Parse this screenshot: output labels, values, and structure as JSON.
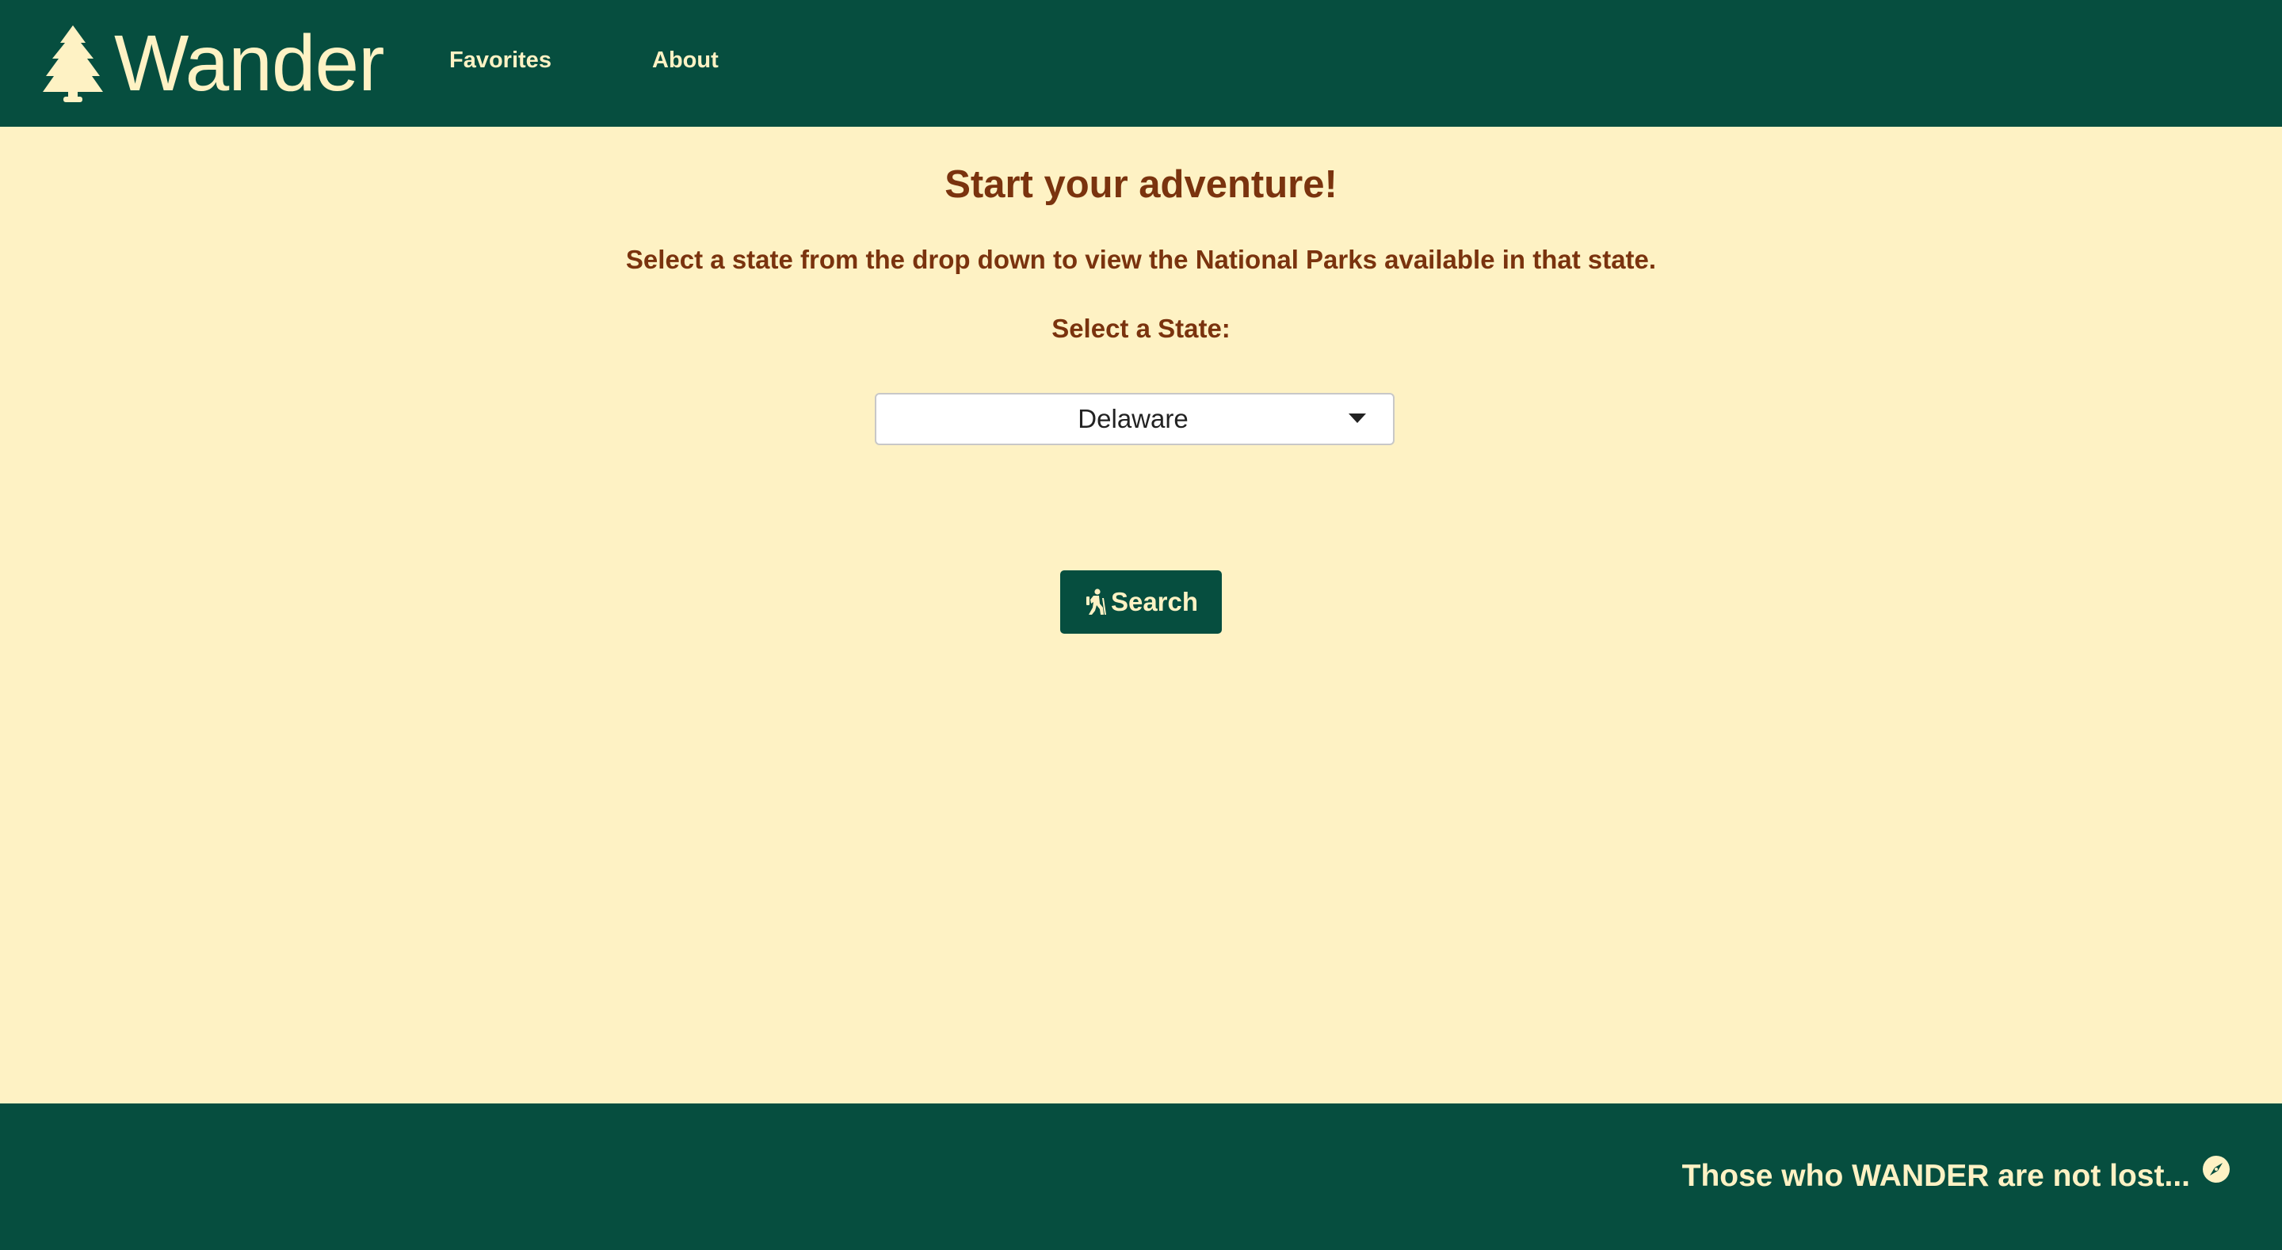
{
  "header": {
    "brand": "Wander",
    "brand_icon": "tree-icon",
    "nav": [
      {
        "label": "Favorites"
      },
      {
        "label": "About"
      }
    ]
  },
  "main": {
    "heading": "Start your adventure!",
    "instructions": "Select a state from the drop down to view the National Parks available in that state.",
    "state_label": "Select a State:",
    "state_select": {
      "selected": "Delaware",
      "icon": "chevron-down-icon"
    },
    "search_button": {
      "label": "Search",
      "icon": "hiking-icon"
    }
  },
  "footer": {
    "tagline": "Those who WANDER are not lost...",
    "icon": "compass-icon"
  },
  "colors": {
    "primary": "#064E3F",
    "background": "#FEF2C4",
    "text_accent": "#7A330E"
  }
}
